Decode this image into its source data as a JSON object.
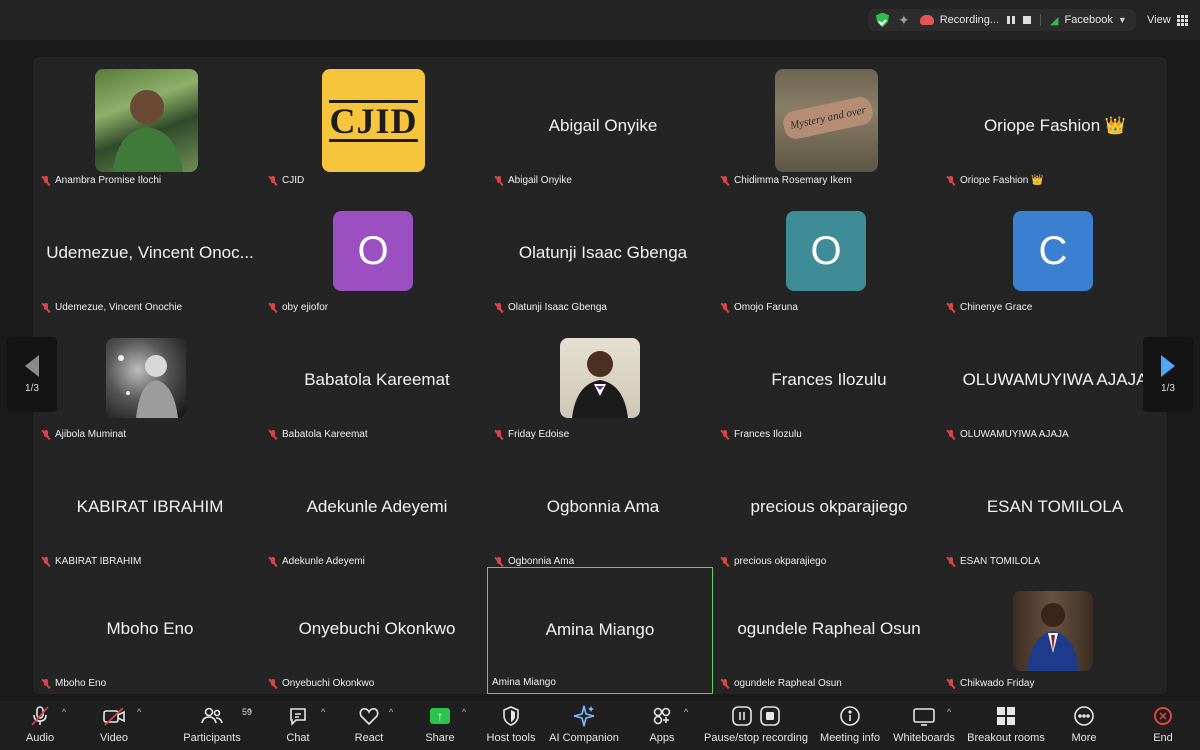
{
  "topbar": {
    "recording_label": "Recording...",
    "stream_label": "Facebook",
    "view_label": "View"
  },
  "pager": {
    "left_page": "1/3",
    "right_page": "1/3"
  },
  "tiles": [
    {
      "display": "",
      "label": "Anambra Promise Ilochi"
    },
    {
      "display": "",
      "label": "CJID",
      "logo_text": "CJID"
    },
    {
      "display": "Abigail Onyike",
      "label": "Abigail Onyike"
    },
    {
      "display": "",
      "label": "Chidimma Rosemary Ikem",
      "photo_text": "Mystery and over"
    },
    {
      "display": "Oriope Fashion 👑",
      "label": "Oriope Fashion 👑"
    },
    {
      "display": "Udemezue, Vincent Onoc...",
      "label": "Udemezue, Vincent Onochie"
    },
    {
      "display": "",
      "label": "oby ejiofor",
      "letter": "O",
      "color": "#9b4fc0"
    },
    {
      "display": "Olatunji Isaac Gbenga",
      "label": "Olatunji Isaac Gbenga"
    },
    {
      "display": "",
      "label": "Omojo Faruna",
      "letter": "O",
      "color": "#3d8c96"
    },
    {
      "display": "",
      "label": "Chinenye Grace",
      "letter": "C",
      "color": "#3a7fd0"
    },
    {
      "display": "",
      "label": "Ajibola Muminat"
    },
    {
      "display": "Babatola Kareemat",
      "label": "Babatola Kareemat"
    },
    {
      "display": "",
      "label": "Friday Edoise"
    },
    {
      "display": "Frances Ilozulu",
      "label": "Frances Ilozulu"
    },
    {
      "display": "OLUWAMUYIWA AJAJA",
      "label": "OLUWAMUYIWA AJAJA"
    },
    {
      "display": "KABIRAT IBRAHIM",
      "label": "KABIRAT IBRAHIM"
    },
    {
      "display": "Adekunle Adeyemi",
      "label": "Adekunle Adeyemi"
    },
    {
      "display": "Ogbonnia Ama",
      "label": "Ogbonnia Ama"
    },
    {
      "display": "precious okparajiego",
      "label": "precious okparajiego"
    },
    {
      "display": "ESAN TOMILOLA",
      "label": "ESAN TOMILOLA"
    },
    {
      "display": "Mboho Eno",
      "label": "Mboho Eno"
    },
    {
      "display": "Onyebuchi Okonkwo",
      "label": "Onyebuchi Okonkwo"
    },
    {
      "display": "Amina Miango",
      "label": "Amina Miango"
    },
    {
      "display": "ogundele Rapheal Osun",
      "label": "ogundele Rapheal Osun"
    },
    {
      "display": "",
      "label": "Chikwado Friday"
    }
  ],
  "toolbar": {
    "audio": "Audio",
    "video": "Video",
    "participants": "Participants",
    "participants_count": "59",
    "chat": "Chat",
    "react": "React",
    "share": "Share",
    "host_tools": "Host tools",
    "ai_companion": "AI Companion",
    "apps": "Apps",
    "pause_recording": "Pause/stop recording",
    "meeting_info": "Meeting info",
    "whiteboards": "Whiteboards",
    "breakout_rooms": "Breakout rooms",
    "more": "More",
    "end": "End"
  },
  "colors": {
    "accent_green": "#2bc44c",
    "muted_red": "#d84545",
    "active_border": "#5bd45b",
    "pager_arrow": "#4fa6f5"
  }
}
